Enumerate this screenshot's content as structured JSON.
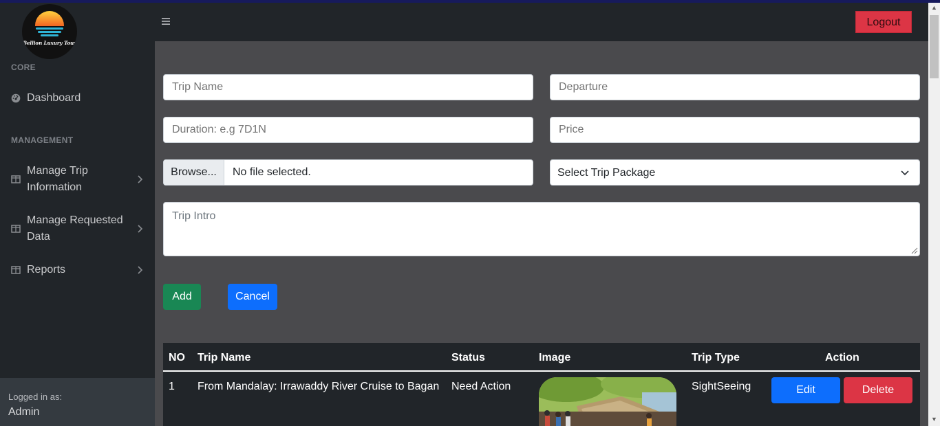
{
  "brand": {
    "name": "Bellion Luxury Tour"
  },
  "sidebar": {
    "core_heading": "CORE",
    "management_heading": "MANAGEMENT",
    "items": [
      {
        "label": "Dashboard",
        "icon": "gauge-icon"
      },
      {
        "label": "Manage Trip Information",
        "icon": "columns-icon",
        "has_submenu": true
      },
      {
        "label": "Manage Requested Data",
        "icon": "columns-icon",
        "has_submenu": true
      },
      {
        "label": "Reports",
        "icon": "columns-icon",
        "has_submenu": true
      }
    ],
    "footer": {
      "logged_in_label": "Logged in as:",
      "user": "Admin"
    }
  },
  "topbar": {
    "logout_label": "Logout"
  },
  "form": {
    "trip_name_placeholder": "Trip Name",
    "departure_placeholder": "Departure",
    "duration_placeholder": "Duration: e.g 7D1N",
    "price_placeholder": "Price",
    "browse_label": "Browse...",
    "file_status": "No file selected.",
    "package_select": "Select Trip Package",
    "intro_placeholder": "Trip Intro",
    "add_label": "Add",
    "cancel_label": "Cancel"
  },
  "table": {
    "headers": [
      "NO",
      "Trip Name",
      "Status",
      "Image",
      "Trip Type",
      "Action"
    ],
    "rows": [
      {
        "no": "1",
        "trip_name": "From Mandalay: Irrawaddy River Cruise to Bagan",
        "status": "Need Action",
        "trip_type": "SightSeeing",
        "edit_label": "Edit",
        "delete_label": "Delete"
      }
    ]
  },
  "colors": {
    "sidebar_bg": "#212529",
    "content_bg": "#4a4a4d",
    "logout": "#dc3545",
    "add": "#198754",
    "primary": "#0d6efd",
    "danger": "#dc3545"
  }
}
